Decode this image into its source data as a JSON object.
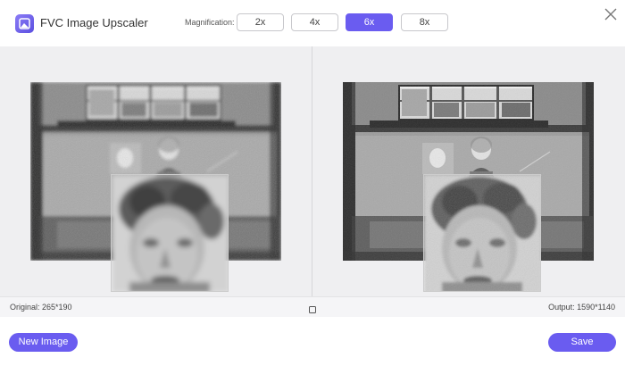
{
  "app": {
    "title": "FVC Image Upscaler",
    "logo_icon": "image-logo-icon",
    "accent_color": "#6a5cf0"
  },
  "magnification": {
    "label": "Magnification:",
    "options": [
      "2x",
      "4x",
      "6x",
      "8x"
    ],
    "selected": "6x"
  },
  "close_icon": "close-icon",
  "status": {
    "original": "Original: 265*190",
    "output": "Output: 1590*1140",
    "compare_icon": "square-compare-icon"
  },
  "footer": {
    "new_image_label": "New Image",
    "save_label": "Save"
  }
}
